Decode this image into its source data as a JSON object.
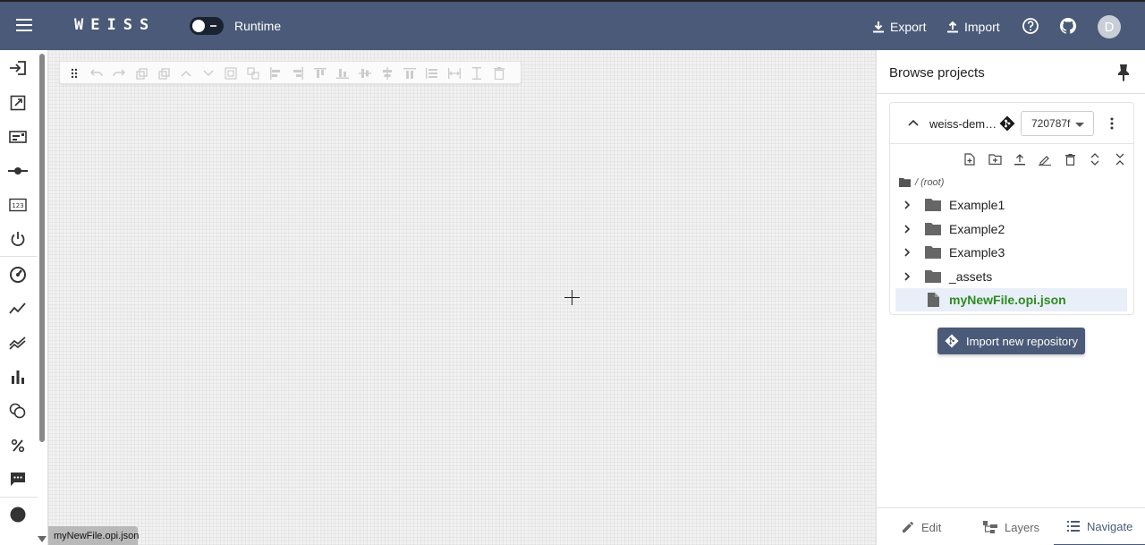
{
  "app": {
    "logo": "WEISS",
    "runtime_label": "Runtime",
    "export_label": "Export",
    "import_label": "Import",
    "avatar_initial": "D"
  },
  "canvas": {
    "open_file_tab": "myNewFile.opi.json"
  },
  "browser": {
    "title": "Browse projects",
    "repo": {
      "name": "weiss-dem…",
      "commit": "720787f"
    },
    "root_label": "/ (root)",
    "tree": [
      {
        "name": "Example1",
        "type": "folder"
      },
      {
        "name": "Example2",
        "type": "folder"
      },
      {
        "name": "Example3",
        "type": "folder"
      },
      {
        "name": "_assets",
        "type": "folder"
      },
      {
        "name": "myNewFile.opi.json",
        "type": "file",
        "selected": true
      }
    ],
    "import_button": "Import new repository"
  },
  "bottom_tabs": [
    {
      "label": "Edit",
      "icon": "pencil-icon"
    },
    {
      "label": "Layers",
      "icon": "layers-icon"
    },
    {
      "label": "Navigate",
      "icon": "list-icon",
      "active": true
    }
  ],
  "colors": {
    "appbar": "#4a5a78",
    "selected_file": "#2e8b22"
  }
}
